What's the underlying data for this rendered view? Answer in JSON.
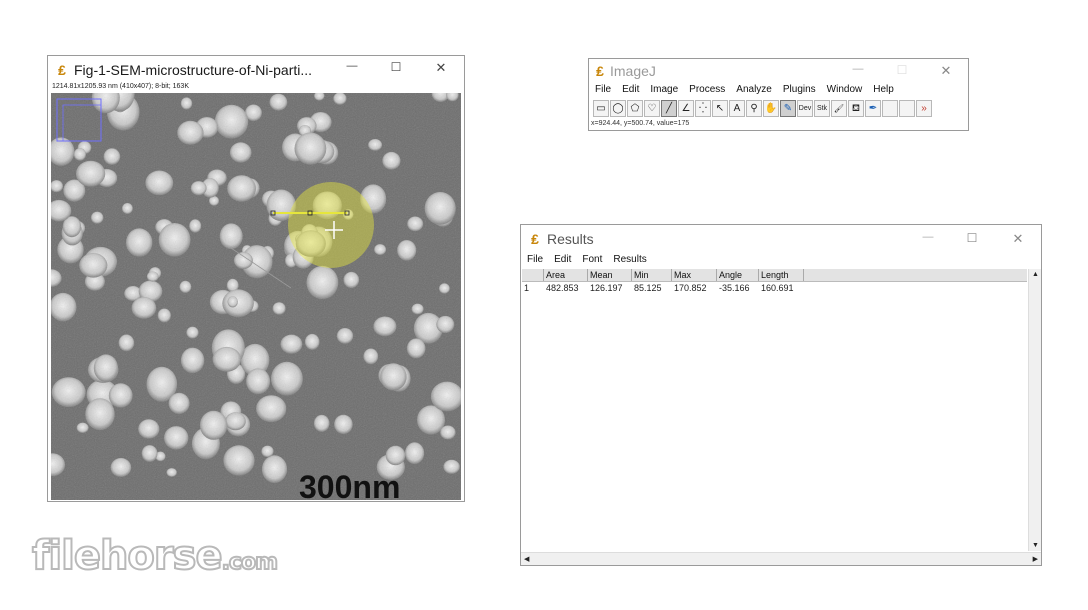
{
  "image_window": {
    "title": "Fig-1-SEM-microstructure-of-Ni-parti...",
    "info": "1214.81x1205.93 nm (410x407); 8-bit; 163K",
    "scale_bar_label": "300nm",
    "minimize": "—",
    "maximize": "☐",
    "close": "✕"
  },
  "imagej_window": {
    "title": "ImageJ",
    "menu": [
      "File",
      "Edit",
      "Image",
      "Process",
      "Analyze",
      "Plugins",
      "Window",
      "Help"
    ],
    "tools": [
      {
        "name": "rectangle-tool-icon",
        "glyph": "▭"
      },
      {
        "name": "oval-tool-icon",
        "glyph": "◯"
      },
      {
        "name": "polygon-tool-icon",
        "glyph": "⬠"
      },
      {
        "name": "freehand-tool-icon",
        "glyph": "♡"
      },
      {
        "name": "line-tool-icon",
        "glyph": "╱"
      },
      {
        "name": "angle-tool-icon",
        "glyph": "∠"
      },
      {
        "name": "point-tool-icon",
        "glyph": "⁛"
      },
      {
        "name": "wand-tool-icon",
        "glyph": "↖"
      },
      {
        "name": "text-tool-icon",
        "glyph": "A"
      },
      {
        "name": "magnifier-tool-icon",
        "glyph": "⚲"
      },
      {
        "name": "hand-tool-icon",
        "glyph": "✋"
      },
      {
        "name": "color-picker-tool-icon",
        "glyph": "✎"
      },
      {
        "name": "dev-menu-icon",
        "glyph": "Dev"
      },
      {
        "name": "stk-menu-icon",
        "glyph": "Stk"
      },
      {
        "name": "brush-tool-icon",
        "glyph": "🖌"
      },
      {
        "name": "flood-fill-tool-icon",
        "glyph": "⛾"
      },
      {
        "name": "dropper-tool-icon",
        "glyph": "✒"
      },
      {
        "name": "empty-slot-icon",
        "glyph": ""
      },
      {
        "name": "empty-slot-icon",
        "glyph": ""
      },
      {
        "name": "more-tools-icon",
        "glyph": "»"
      }
    ],
    "status": "x=924.44, y=500.74, value=175",
    "minimize": "—",
    "maximize": "☐",
    "close": "✕"
  },
  "results_window": {
    "title": "Results",
    "menu": [
      "File",
      "Edit",
      "Font",
      "Results"
    ],
    "columns": [
      "",
      "Area",
      "Mean",
      "Min",
      "Max",
      "Angle",
      "Length"
    ],
    "rows": [
      [
        "1",
        "482.853",
        "126.197",
        "85.125",
        "170.852",
        "-35.166",
        "160.691"
      ]
    ],
    "minimize": "—",
    "maximize": "☐",
    "close": "✕"
  },
  "watermark": {
    "brand": "filehorse",
    "suffix": ".com"
  },
  "colors": {
    "title_icon": "#c8860a",
    "selection_yellow": "#e6e63c",
    "roi_box": "#7070ff"
  }
}
